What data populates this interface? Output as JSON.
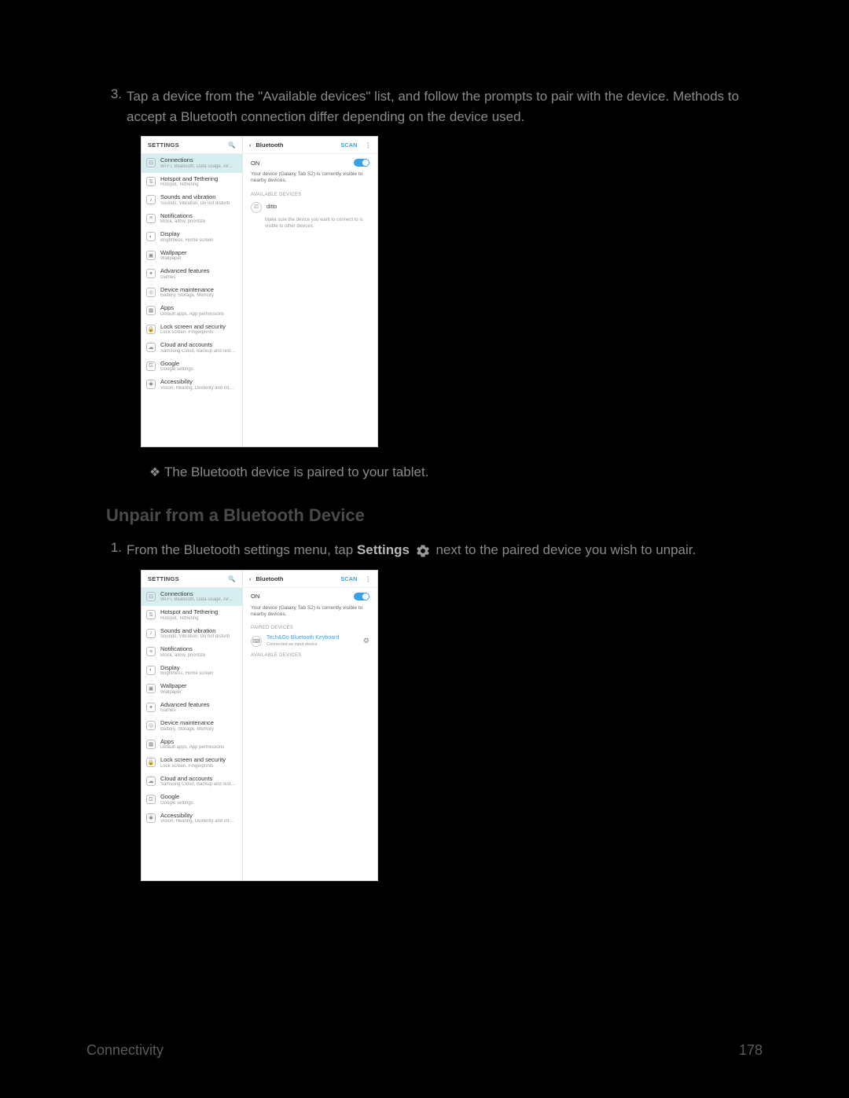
{
  "step3": {
    "num": "3.",
    "text": "Tap a device from the \"Available devices\" list, and follow the prompts to pair with the device. Methods to accept a Bluetooth connection differ depending on the device used."
  },
  "bullet1": {
    "mark": "❖",
    "text": "The Bluetooth device is paired to your tablet."
  },
  "heading_unpair": "Unpair from a Bluetooth Device",
  "step_unpair": {
    "num": "1.",
    "pre": "From the Bluetooth settings menu, tap ",
    "bold": "Settings",
    "post": " next to the paired device you wish to unpair."
  },
  "footer": {
    "left": "Connectivity",
    "right": "178"
  },
  "phone": {
    "header_left": "SETTINGS",
    "search_glyph": "🔍",
    "items": [
      {
        "t": "Connections",
        "s": "Wi-Fi, Bluetooth, Data usage, Airplane m..."
      },
      {
        "t": "Hotspot and Tethering",
        "s": "Hotspot, Tethering"
      },
      {
        "t": "Sounds and vibration",
        "s": "Sounds, Vibration, Do not disturb"
      },
      {
        "t": "Notifications",
        "s": "Block, allow, prioritize"
      },
      {
        "t": "Display",
        "s": "Brightness, Home screen"
      },
      {
        "t": "Wallpaper",
        "s": "Wallpaper"
      },
      {
        "t": "Advanced features",
        "s": "Games"
      },
      {
        "t": "Device maintenance",
        "s": "Battery, Storage, Memory"
      },
      {
        "t": "Apps",
        "s": "Default apps, App permissions"
      },
      {
        "t": "Lock screen and security",
        "s": "Lock screen, Fingerprints"
      },
      {
        "t": "Cloud and accounts",
        "s": "Samsung Cloud, Backup and restore"
      },
      {
        "t": "Google",
        "s": "Google settings"
      },
      {
        "t": "Accessibility",
        "s": "Vision, Hearing, Dexterity and interaction"
      }
    ],
    "right": {
      "back": "‹",
      "title": "Bluetooth",
      "scan": "SCAN",
      "dots": "⋮",
      "on": "ON",
      "note": "Your device (Galaxy Tab S2) is currently visible to nearby devices.",
      "avail_cap": "AVAILABLE DEVICES",
      "paired_cap": "PAIRED DEVICES",
      "device1": "ditto",
      "help": "Make sure the device you want to connect to is visible to other devices.",
      "paired_name": "Tech&Go Bluetooth Keyboard",
      "paired_sub": "Connected as input device"
    }
  }
}
